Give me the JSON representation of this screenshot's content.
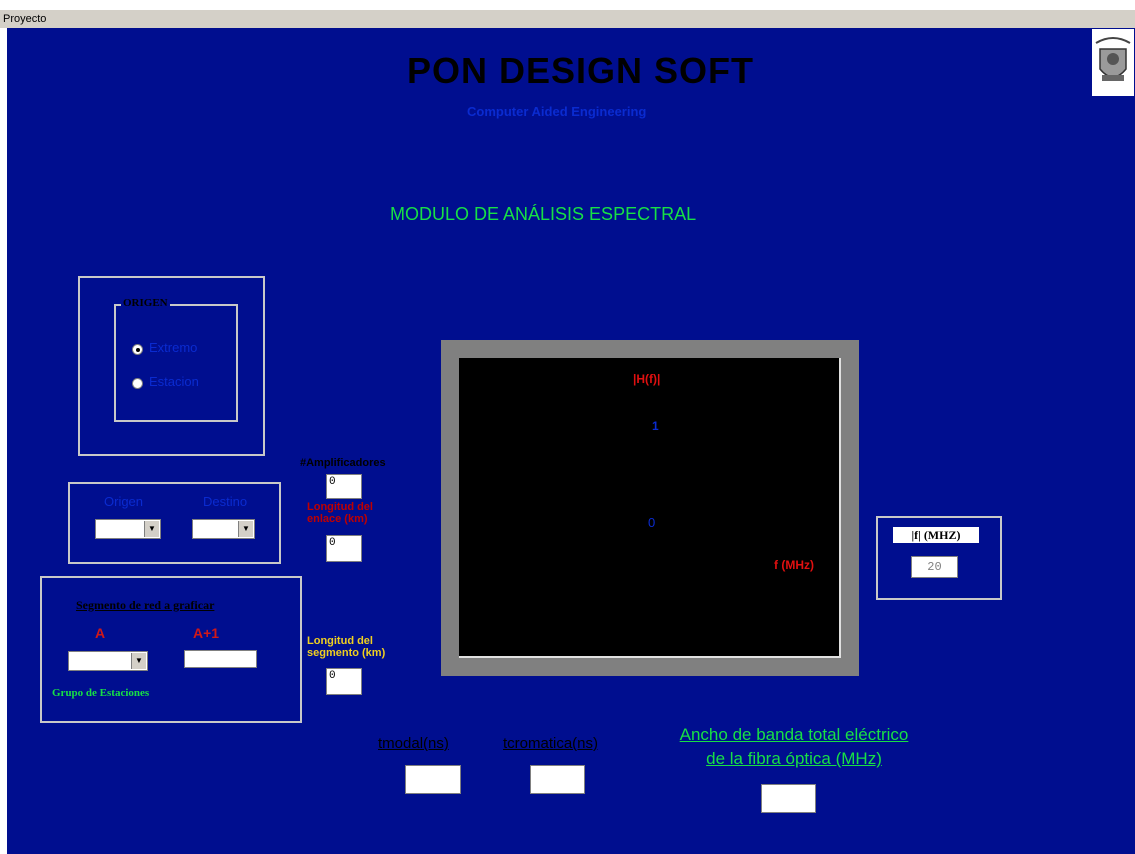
{
  "menu": {
    "proyecto": "Proyecto"
  },
  "header": {
    "title": "PON DESIGN SOFT",
    "subtitle": "Computer Aided Engineering",
    "module": "MODULO DE ANÁLISIS ESPECTRAL"
  },
  "origen": {
    "legend": "ORIGEN",
    "options": [
      "Extremo",
      "Estacion"
    ],
    "selected": "Extremo"
  },
  "od": {
    "origen_label": "Origen",
    "destino_label": "Destino",
    "origen_value": "",
    "destino_value": ""
  },
  "amplificadores": {
    "label": "#Amplificadores",
    "value": "0"
  },
  "longitud_enlace": {
    "label": "Longitud del enlace (km)",
    "value": "0"
  },
  "segmento": {
    "legend": "Segmento de red a graficar",
    "a_label": "A",
    "a1_label": "A+1",
    "a_value": "",
    "a1_value": "",
    "grupo_label": "Grupo de Estaciones"
  },
  "longitud_segmento": {
    "label": "Longitud del segmento (km)",
    "value": "0"
  },
  "chart": {
    "y_title": "|H(f)|",
    "tick_1": "1",
    "tick_0": "0",
    "x_title": "f (MHz)"
  },
  "freq": {
    "label": "|f| (MHZ)",
    "value": "20"
  },
  "bottom": {
    "tmodal_label": "tmodal(ns)",
    "tcromatica_label": "tcromatica(ns)",
    "bw_line1": "Ancho de banda total eléctrico",
    "bw_line2": "de la fibra óptica (MHz)",
    "tmodal_value": "",
    "tcromatica_value": "",
    "bw_value": ""
  },
  "colors": {
    "background": "#000e8f",
    "accent_green": "#17e045",
    "chart_bg": "#000000"
  }
}
